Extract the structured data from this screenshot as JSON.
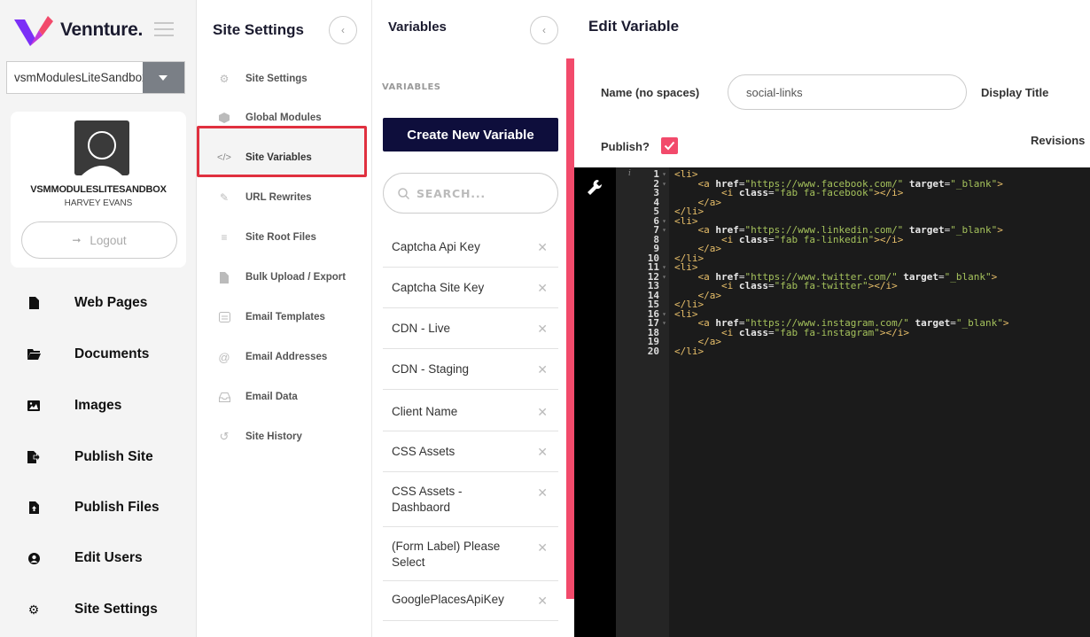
{
  "brand": {
    "name": "Vennture."
  },
  "site_select": {
    "value": "vsmModulesLiteSandbox"
  },
  "profile": {
    "name": "VSMMODULESLITESANDBOX",
    "user": "HARVEY EVANS",
    "logout_label": "Logout"
  },
  "main_nav": [
    {
      "label": "Web Pages",
      "icon": "file-icon"
    },
    {
      "label": "Documents",
      "icon": "folder-icon"
    },
    {
      "label": "Images",
      "icon": "image-icon"
    },
    {
      "label": "Publish Site",
      "icon": "publish-icon"
    },
    {
      "label": "Publish Files",
      "icon": "file-upload-icon"
    },
    {
      "label": "Edit Users",
      "icon": "user-icon"
    },
    {
      "label": "Site Settings",
      "icon": "gear-icon"
    }
  ],
  "settings_panel": {
    "title": "Site Settings",
    "items": [
      {
        "label": "Site Settings",
        "icon": "gear-icon"
      },
      {
        "label": "Global Modules",
        "icon": "cube-icon"
      },
      {
        "label": "Site Variables",
        "icon": "code-icon",
        "active": true
      },
      {
        "label": "URL Rewrites",
        "icon": "pencil-icon"
      },
      {
        "label": "Site Root Files",
        "icon": "layers-icon"
      },
      {
        "label": "Bulk Upload / Export",
        "icon": "file-icon"
      },
      {
        "label": "Email Templates",
        "icon": "email-template-icon"
      },
      {
        "label": "Email Addresses",
        "icon": "at-icon"
      },
      {
        "label": "Email Data",
        "icon": "inbox-icon"
      },
      {
        "label": "Site History",
        "icon": "history-icon"
      }
    ]
  },
  "variables_panel": {
    "title": "Variables",
    "section_label": "VARIABLES",
    "create_label": "Create New Variable",
    "search_placeholder": "SEARCH...",
    "items": [
      "Captcha Api Key",
      "Captcha Site Key",
      "CDN - Live",
      "CDN - Staging",
      "Client Name",
      "CSS Assets",
      "CSS Assets - Dashbaord",
      "(Form Label) Please Select",
      "GooglePlacesApiKey"
    ]
  },
  "edit_panel": {
    "title": "Edit Variable",
    "name_label": "Name (no spaces)",
    "name_value": "social-links",
    "display_title_label": "Display Title",
    "publish_label": "Publish?",
    "publish_checked": true,
    "revisions_label": "Revisions"
  },
  "code_lines": [
    "<li>",
    "    <a href=\"https://www.facebook.com/\" target=\"_blank\">",
    "        <i class=\"fab fa-facebook\"></i>",
    "    </a>",
    "</li>",
    "<li>",
    "    <a href=\"https://www.linkedin.com/\" target=\"_blank\">",
    "        <i class=\"fab fa-linkedin\"></i>",
    "    </a>",
    "</li>",
    "<li>",
    "    <a href=\"https://www.twitter.com/\" target=\"_blank\">",
    "        <i class=\"fab fa-twitter\"></i>",
    "    </a>",
    "</li>",
    "<li>",
    "    <a href=\"https://www.instagram.com/\" target=\"_blank\">",
    "        <i class=\"fab fa-instagram\"></i>",
    "    </a>",
    "</li>"
  ],
  "colors": {
    "accent": "#f24a6b",
    "navy": "#0e0e3c",
    "highlight_border": "#e0303f"
  }
}
